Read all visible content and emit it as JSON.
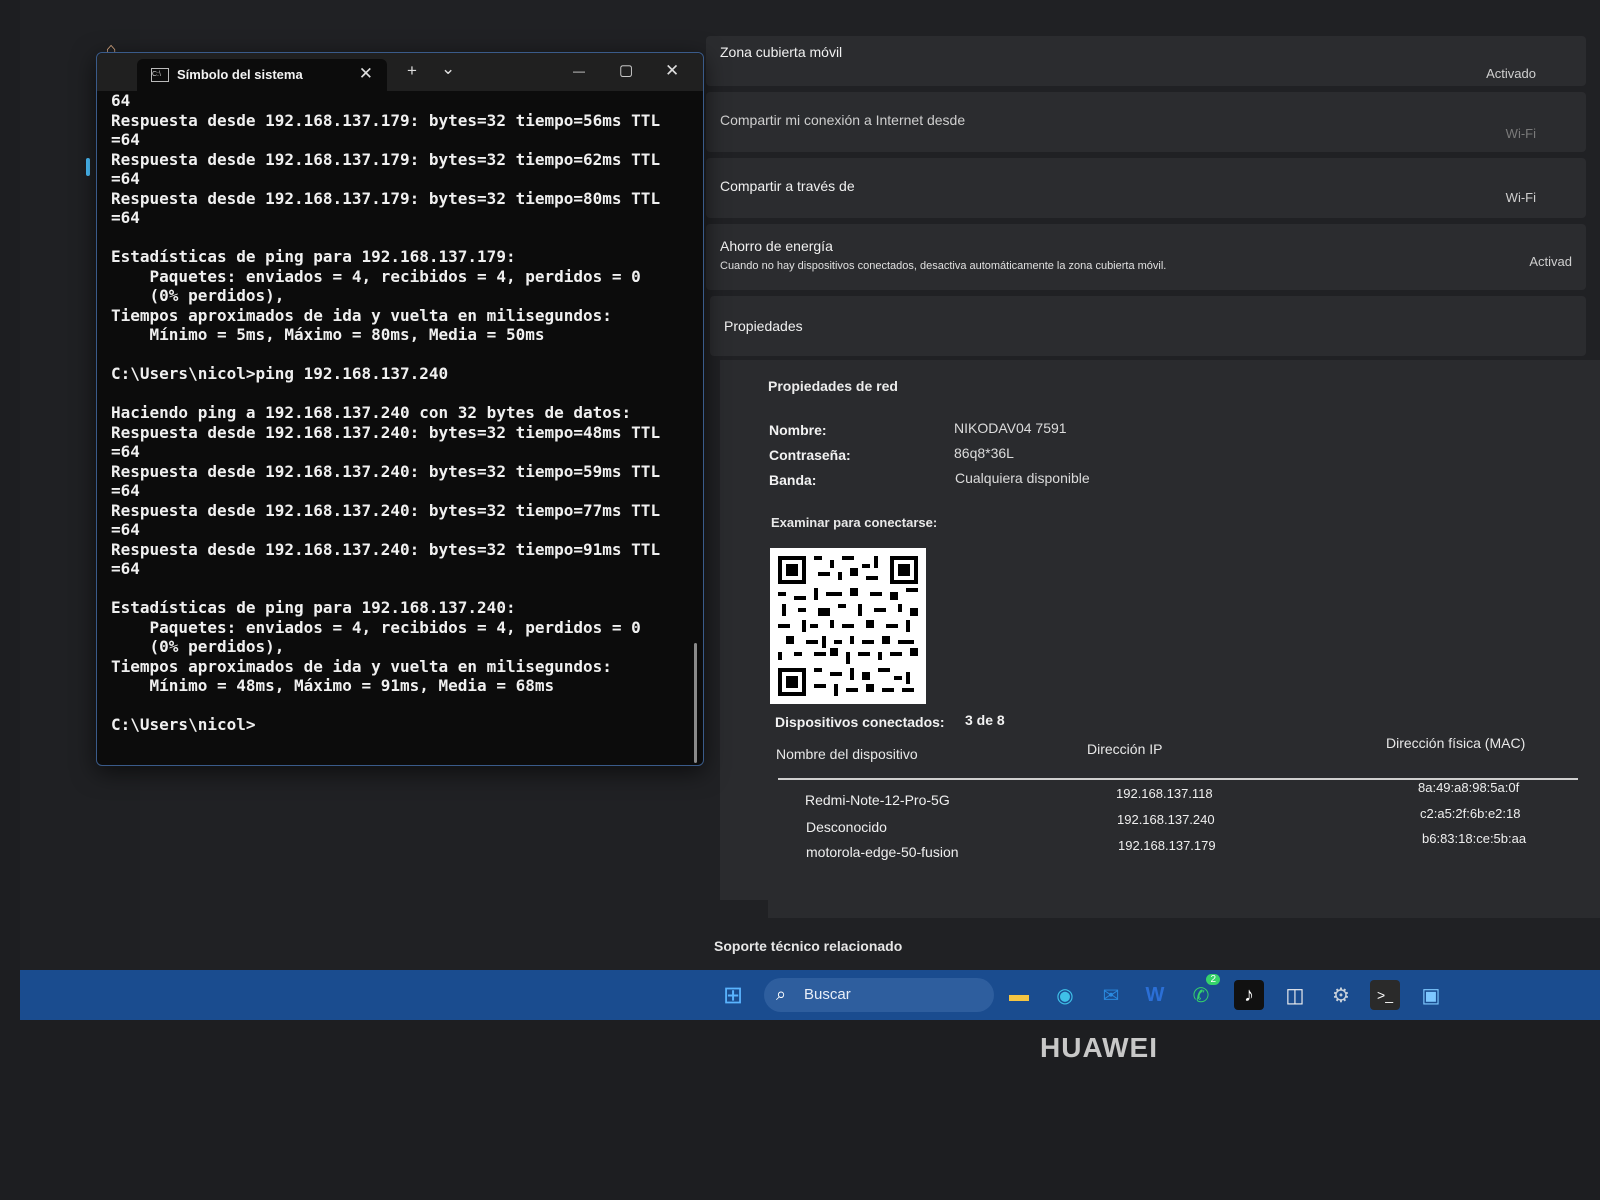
{
  "brand": "HUAWEI",
  "settings": {
    "rows": [
      {
        "label": "Zona cubierta móvil",
        "value": "Activado"
      },
      {
        "label": "Compartir mi conexión a Internet desde",
        "value": "Wi-Fi"
      },
      {
        "label": "Compartir a través de",
        "value": "Wi-Fi"
      },
      {
        "label": "Ahorro de energía",
        "sub": "Cuando no hay dispositivos conectados, desactiva automáticamente la zona cubierta móvil.",
        "value": "Activad"
      }
    ],
    "properties_label": "Propiedades",
    "network_props_title": "Propiedades de red",
    "fields": [
      {
        "key": "Nombre:",
        "value": "NIKODAV04 7591"
      },
      {
        "key": "Contraseña:",
        "value": "86q8*36L"
      },
      {
        "key": "Banda:",
        "value": "Cualquiera disponible"
      }
    ],
    "scan_label": "Examinar para conectarse:",
    "connected_label": "Dispositivos conectados:",
    "connected_count": "3 de 8",
    "table_headers": [
      "Nombre del dispositivo",
      "Dirección IP",
      "Dirección física (MAC)"
    ],
    "devices": [
      {
        "name": "Redmi-Note-12-Pro-5G",
        "ip": "192.168.137.118",
        "mac": "8a:49:a8:98:5a:0f"
      },
      {
        "name": "Desconocido",
        "ip": "192.168.137.240",
        "mac": "c2:a5:2f:6b:e2:18"
      },
      {
        "name": "motorola-edge-50-fusion",
        "ip": "192.168.137.179",
        "mac": "b6:83:18:ce:5b:aa"
      }
    ],
    "footer_text": "Soporte técnico relacionado"
  },
  "terminal": {
    "tab_title": "Símbolo del sistema",
    "new_tab": "+",
    "dropdown": "⌄",
    "minimize": "—",
    "maximize": "▢",
    "close": "✕",
    "tab_close": "✕",
    "lines": [
      "64",
      "Respuesta desde 192.168.137.179: bytes=32 tiempo=56ms TTL",
      "=64",
      "Respuesta desde 192.168.137.179: bytes=32 tiempo=62ms TTL",
      "=64",
      "Respuesta desde 192.168.137.179: bytes=32 tiempo=80ms TTL",
      "=64",
      "",
      "Estadísticas de ping para 192.168.137.179:",
      "    Paquetes: enviados = 4, recibidos = 4, perdidos = 0",
      "    (0% perdidos),",
      "Tiempos aproximados de ida y vuelta en milisegundos:",
      "    Mínimo = 5ms, Máximo = 80ms, Media = 50ms",
      "",
      "C:\\Users\\nicol>ping 192.168.137.240",
      "",
      "Haciendo ping a 192.168.137.240 con 32 bytes de datos:",
      "Respuesta desde 192.168.137.240: bytes=32 tiempo=48ms TTL",
      "=64",
      "Respuesta desde 192.168.137.240: bytes=32 tiempo=59ms TTL",
      "=64",
      "Respuesta desde 192.168.137.240: bytes=32 tiempo=77ms TTL",
      "=64",
      "Respuesta desde 192.168.137.240: bytes=32 tiempo=91ms TTL",
      "=64",
      "",
      "Estadísticas de ping para 192.168.137.240:",
      "    Paquetes: enviados = 4, recibidos = 4, perdidos = 0",
      "    (0% perdidos),",
      "Tiempos aproximados de ida y vuelta en milisegundos:",
      "    Mínimo = 48ms, Máximo = 91ms, Media = 68ms",
      "",
      "C:\\Users\\nicol>"
    ]
  },
  "taskbar": {
    "search_placeholder": "Buscar",
    "whatsapp_badge": "2"
  },
  "colors": {
    "taskbar": "#1a4c8f",
    "accent": "#4cc2ff",
    "terminal_bg": "#0c0c0c"
  }
}
